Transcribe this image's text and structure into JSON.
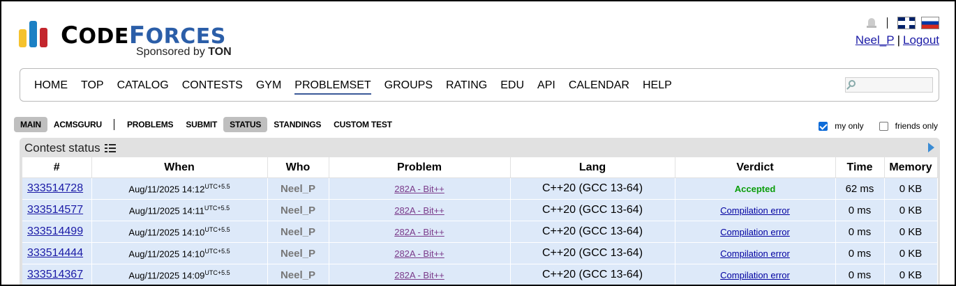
{
  "brand": {
    "name_first": "C",
    "name_rest1": "ODE",
    "name_cap2": "F",
    "name_rest2": "ORCES",
    "sponsor_prefix": "Sponsored by ",
    "sponsor_brand": "TON"
  },
  "user": {
    "handle": "Neel_P",
    "logout": "Logout",
    "separator": "|"
  },
  "main_menu": {
    "items": [
      "HOME",
      "TOP",
      "CATALOG",
      "CONTESTS",
      "GYM",
      "PROBLEMSET",
      "GROUPS",
      "RATING",
      "EDU",
      "API",
      "CALENDAR",
      "HELP"
    ],
    "active": "PROBLEMSET",
    "search_value": ""
  },
  "sub_menu": {
    "left": [
      "MAIN",
      "ACMSGURU"
    ],
    "right": [
      "PROBLEMS",
      "SUBMIT",
      "STATUS",
      "STANDINGS",
      "CUSTOM TEST"
    ],
    "selected": [
      "MAIN",
      "STATUS"
    ]
  },
  "filters": {
    "my_only": "my only",
    "my_only_checked": true,
    "friends_only": "friends only",
    "friends_only_checked": false
  },
  "status": {
    "caption": "Contest status",
    "columns": [
      "#",
      "When",
      "Who",
      "Problem",
      "Lang",
      "Verdict",
      "Time",
      "Memory"
    ],
    "rows": [
      {
        "id": "333514728",
        "when": "Aug/11/2025 14:12",
        "tz": "UTC+5.5",
        "who": "Neel_P",
        "problem": "282A - Bit++",
        "lang": "C++20 (GCC 13-64)",
        "verdict": "Accepted",
        "time": "62 ms",
        "memory": "0 KB"
      },
      {
        "id": "333514577",
        "when": "Aug/11/2025 14:11",
        "tz": "UTC+5.5",
        "who": "Neel_P",
        "problem": "282A - Bit++",
        "lang": "C++20 (GCC 13-64)",
        "verdict": "Compilation error",
        "time": "0 ms",
        "memory": "0 KB"
      },
      {
        "id": "333514499",
        "when": "Aug/11/2025 14:10",
        "tz": "UTC+5.5",
        "who": "Neel_P",
        "problem": "282A - Bit++",
        "lang": "C++20 (GCC 13-64)",
        "verdict": "Compilation error",
        "time": "0 ms",
        "memory": "0 KB"
      },
      {
        "id": "333514444",
        "when": "Aug/11/2025 14:10",
        "tz": "UTC+5.5",
        "who": "Neel_P",
        "problem": "282A - Bit++",
        "lang": "C++20 (GCC 13-64)",
        "verdict": "Compilation error",
        "time": "0 ms",
        "memory": "0 KB"
      },
      {
        "id": "333514367",
        "when": "Aug/11/2025 14:09",
        "tz": "UTC+5.5",
        "who": "Neel_P",
        "problem": "282A - Bit++",
        "lang": "C++20 (GCC 13-64)",
        "verdict": "Compilation error",
        "time": "0 ms",
        "memory": "0 KB"
      }
    ]
  },
  "colors": {
    "accepted": "#0a9d0a",
    "row_bg": "#dde9f9",
    "link": "#1a1aa6",
    "logo_yellow": "#f5c22e",
    "logo_blue": "#1b80c4",
    "logo_red": "#c3262d"
  },
  "icons": [
    "bell-icon",
    "uk-flag-icon",
    "ru-flag-icon",
    "search-icon",
    "list-icon",
    "expand-arrow-icon"
  ]
}
